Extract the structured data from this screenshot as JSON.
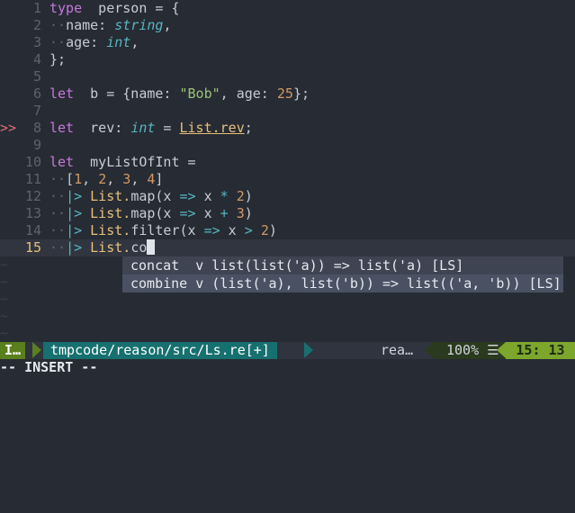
{
  "editor": {
    "lines": [
      {
        "num": "1",
        "sign": "",
        "segments": [
          [
            "kw",
            "type"
          ],
          [
            "",
            "  person = {"
          ]
        ]
      },
      {
        "num": "2",
        "sign": "",
        "segments": [
          [
            "dot",
            "··"
          ],
          [
            "",
            "name: "
          ],
          [
            "ty",
            "string"
          ],
          [
            "",
            ","
          ]
        ]
      },
      {
        "num": "3",
        "sign": "",
        "segments": [
          [
            "dot",
            "··"
          ],
          [
            "",
            "age: "
          ],
          [
            "ty",
            "int"
          ],
          [
            "",
            ","
          ]
        ]
      },
      {
        "num": "4",
        "sign": "",
        "segments": [
          [
            "",
            "};"
          ]
        ]
      },
      {
        "num": "5",
        "sign": "",
        "segments": []
      },
      {
        "num": "6",
        "sign": "",
        "segments": [
          [
            "kw",
            "let"
          ],
          [
            "",
            "  b = {name: "
          ],
          [
            "str",
            "\"Bob\""
          ],
          [
            "",
            ", age: "
          ],
          [
            "num",
            "25"
          ],
          [
            "",
            "};"
          ]
        ]
      },
      {
        "num": "7",
        "sign": "",
        "segments": []
      },
      {
        "num": "8",
        "sign": ">>",
        "segments": [
          [
            "kw",
            "let"
          ],
          [
            "",
            "  rev: "
          ],
          [
            "ty",
            "int"
          ],
          [
            "",
            " = "
          ],
          [
            "mod",
            "List.rev"
          ],
          [
            "",
            ";"
          ]
        ]
      },
      {
        "num": "9",
        "sign": "",
        "segments": []
      },
      {
        "num": "10",
        "sign": "",
        "segments": [
          [
            "kw",
            "let"
          ],
          [
            "",
            "  myListOfInt ="
          ]
        ]
      },
      {
        "num": "11",
        "sign": "",
        "segments": [
          [
            "dot",
            "··"
          ],
          [
            "",
            "["
          ],
          [
            "num",
            "1"
          ],
          [
            "",
            ", "
          ],
          [
            "num",
            "2"
          ],
          [
            "",
            ", "
          ],
          [
            "num",
            "3"
          ],
          [
            "",
            ", "
          ],
          [
            "num",
            "4"
          ],
          [
            "",
            "]"
          ]
        ]
      },
      {
        "num": "12",
        "sign": "",
        "segments": [
          [
            "dot",
            "··"
          ],
          [
            "op",
            "|>"
          ],
          [
            "",
            " "
          ],
          [
            "fn",
            "List."
          ],
          [
            "",
            "map(x "
          ],
          [
            "op",
            "=>"
          ],
          [
            "",
            " x "
          ],
          [
            "op",
            "*"
          ],
          [
            "",
            " "
          ],
          [
            "num",
            "2"
          ],
          [
            "",
            ")"
          ]
        ]
      },
      {
        "num": "13",
        "sign": "",
        "segments": [
          [
            "dot",
            "··"
          ],
          [
            "op",
            "|>"
          ],
          [
            "",
            " "
          ],
          [
            "fn",
            "List."
          ],
          [
            "",
            "map(x "
          ],
          [
            "op",
            "=>"
          ],
          [
            "",
            " x "
          ],
          [
            "op",
            "+"
          ],
          [
            "",
            " "
          ],
          [
            "num",
            "3"
          ],
          [
            "",
            ")"
          ]
        ]
      },
      {
        "num": "14",
        "sign": "",
        "segments": [
          [
            "dot",
            "··"
          ],
          [
            "op",
            "|>"
          ],
          [
            "",
            " "
          ],
          [
            "fn",
            "List."
          ],
          [
            "",
            "filter(x "
          ],
          [
            "op",
            "=>"
          ],
          [
            "",
            " x "
          ],
          [
            "op",
            ">"
          ],
          [
            "",
            " "
          ],
          [
            "num",
            "2"
          ],
          [
            "",
            ")"
          ]
        ]
      },
      {
        "num": "15",
        "sign": "",
        "segments": [
          [
            "dot",
            "··"
          ],
          [
            "op",
            "|>"
          ],
          [
            "",
            " "
          ],
          [
            "fn",
            "List."
          ],
          [
            "",
            "co"
          ]
        ],
        "current": true
      }
    ],
    "tilde": "~"
  },
  "completion": {
    "items": [
      "concat  v list(list('a)) => list('a) [LS]",
      "combine v (list('a), list('b)) => list(('a, 'b)) [LS]"
    ]
  },
  "statusbar": {
    "mode": "I…",
    "file": "tmpcode/reason/src/Ls.re[+]",
    "filetype": "rea…",
    "percent": "100% ☰",
    "position": "15: 13"
  },
  "cmdline": "-- INSERT --",
  "colors": {
    "background": "#272b33",
    "mode_bg": "#5a7f1e",
    "file_bg": "#16706f",
    "position_bg": "#7da62c"
  }
}
